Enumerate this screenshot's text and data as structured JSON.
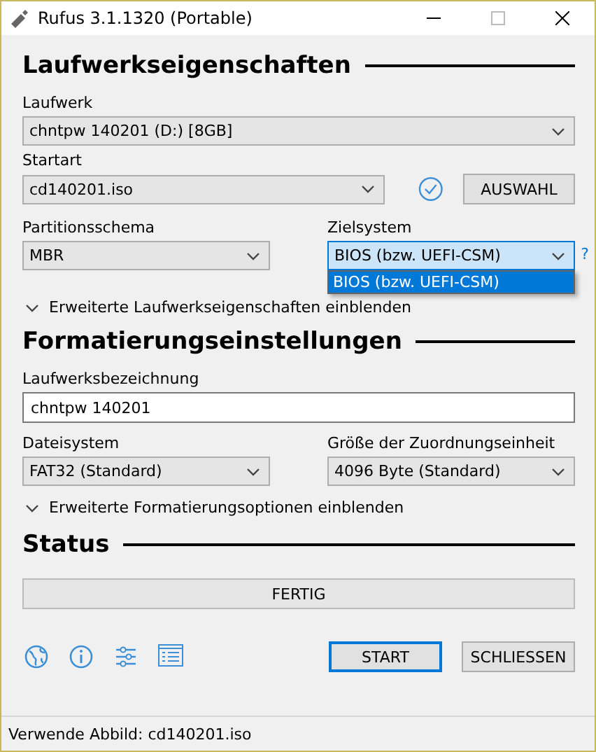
{
  "window": {
    "title": "Rufus 3.1.1320 (Portable)"
  },
  "drive_properties": {
    "heading": "Laufwerkseigenschaften",
    "device": {
      "label": "Laufwerk",
      "value": "chntpw 140201 (D:) [8GB]"
    },
    "boot_selection": {
      "label": "Startart",
      "value": "cd140201.iso",
      "select_button": "AUSWAHL"
    },
    "partition_scheme": {
      "label": "Partitionsschema",
      "value": "MBR"
    },
    "target_system": {
      "label": "Zielsystem",
      "value": "BIOS (bzw. UEFI-CSM)",
      "help": "?",
      "expanded": true,
      "options": [
        {
          "label": "BIOS (bzw. UEFI-CSM)",
          "selected": true
        }
      ]
    },
    "advanced_toggle": "Erweiterte Laufwerkseigenschaften einblenden"
  },
  "format_options": {
    "heading": "Formatierungseinstellungen",
    "volume_label": {
      "label": "Laufwerksbezeichnung",
      "value": "chntpw 140201"
    },
    "file_system": {
      "label": "Dateisystem",
      "value": "FAT32 (Standard)"
    },
    "cluster_size": {
      "label": "Größe der Zuordnungseinheit",
      "value": "4096 Byte (Standard)"
    },
    "advanced_toggle": "Erweiterte Formatierungsoptionen einblenden"
  },
  "status": {
    "heading": "Status",
    "progress_text": "FERTIG"
  },
  "buttons": [
    {
      "label": "START",
      "focused": true
    },
    {
      "label": "SCHLIESSEN",
      "focused": false
    }
  ],
  "status_bar": "Verwende Abbild: cd140201.iso"
}
